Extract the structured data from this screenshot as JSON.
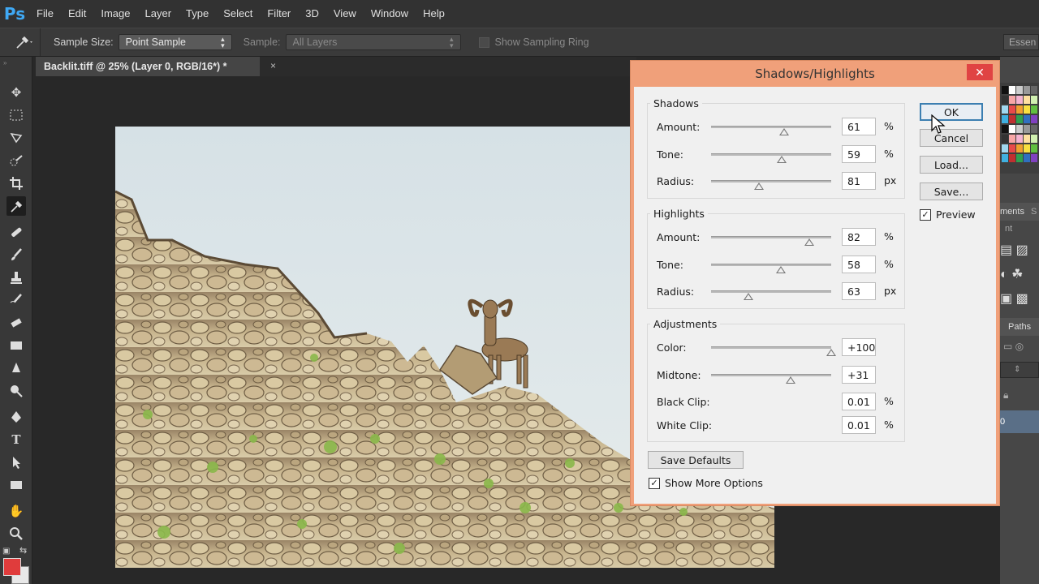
{
  "app": {
    "logo": "Ps"
  },
  "menu": [
    "File",
    "Edit",
    "Image",
    "Layer",
    "Type",
    "Select",
    "Filter",
    "3D",
    "View",
    "Window",
    "Help"
  ],
  "options": {
    "sample_size_label": "Sample Size:",
    "sample_size_value": "Point Sample",
    "sample_label": "Sample:",
    "sample_value": "All Layers",
    "show_ring_label": "Show Sampling Ring",
    "workspace": "Essen"
  },
  "document": {
    "tab_title": "Backlit.tiff @ 25% (Layer 0, RGB/16*) *",
    "close": "×"
  },
  "right_panel": {
    "panel_tab_1": "ments",
    "panel_tab_2": "S",
    "panel_label": "nt",
    "paths_tab": "Paths",
    "layer_num": "0"
  },
  "dialog": {
    "title": "Shadows/Highlights",
    "close": "✕",
    "shadows": {
      "title": "Shadows",
      "amount": {
        "label": "Amount:",
        "value": "61",
        "unit": "%",
        "pos": 61
      },
      "tone": {
        "label": "Tone:",
        "value": "59",
        "unit": "%",
        "pos": 59
      },
      "radius": {
        "label": "Radius:",
        "value": "81",
        "unit": "px",
        "pos": 40
      }
    },
    "highlights": {
      "title": "Highlights",
      "amount": {
        "label": "Amount:",
        "value": "82",
        "unit": "%",
        "pos": 82
      },
      "tone": {
        "label": "Tone:",
        "value": "58",
        "unit": "%",
        "pos": 58
      },
      "radius": {
        "label": "Radius:",
        "value": "63",
        "unit": "px",
        "pos": 31
      }
    },
    "adjustments": {
      "title": "Adjustments",
      "color": {
        "label": "Color:",
        "value": "+100",
        "pos": 100
      },
      "midtone": {
        "label": "Midtone:",
        "value": "+31",
        "pos": 66
      },
      "black_clip": {
        "label": "Black Clip:",
        "value": "0.01",
        "unit": "%"
      },
      "white_clip": {
        "label": "White Clip:",
        "value": "0.01",
        "unit": "%"
      }
    },
    "buttons": {
      "ok": "OK",
      "cancel": "Cancel",
      "load": "Load...",
      "save": "Save...",
      "save_defaults": "Save Defaults"
    },
    "preview": {
      "label": "Preview",
      "checked": true
    },
    "more_options": {
      "label": "Show More Options",
      "checked": true
    }
  },
  "colors": {
    "accent": "#3fa9f5",
    "dialog_frame": "#f0a07a",
    "foreground_swatch": "#e03c3c"
  }
}
